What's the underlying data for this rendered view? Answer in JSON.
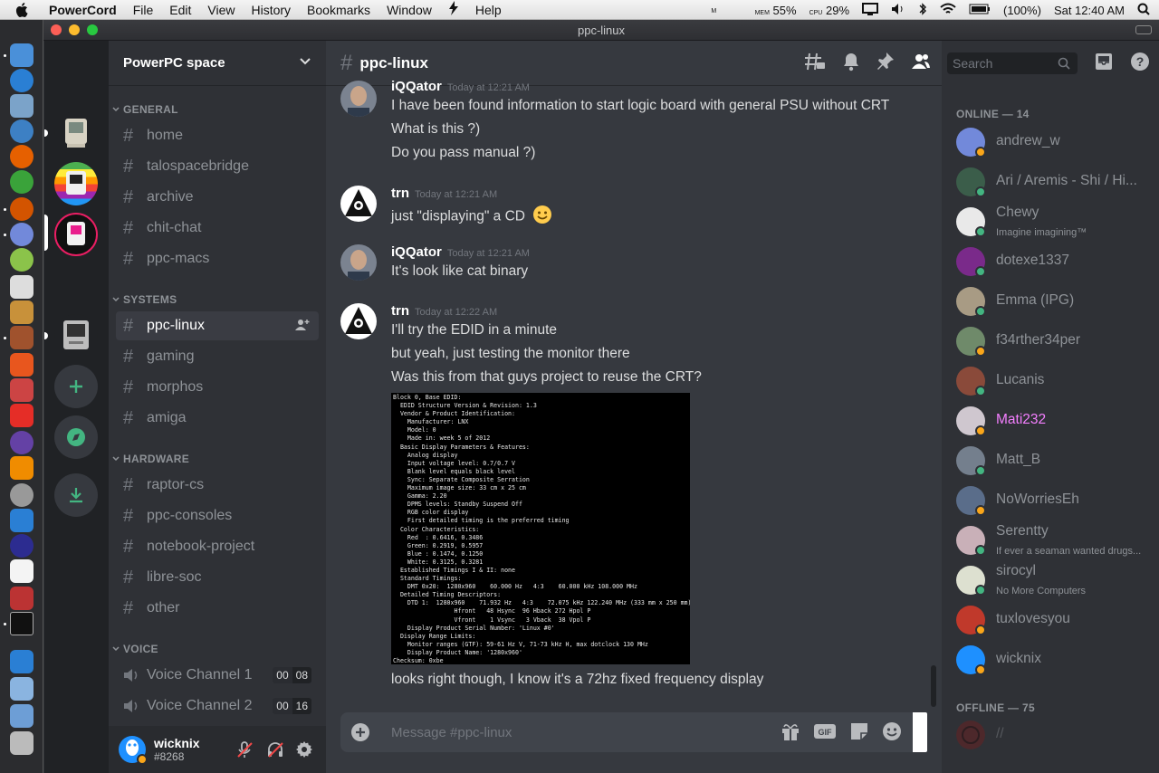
{
  "menubar": {
    "app": "PowerCord",
    "items": [
      "File",
      "Edit",
      "View",
      "History",
      "Bookmarks",
      "Window",
      "Help"
    ],
    "status": {
      "temp": "116°",
      "mem": "55%",
      "cpu": "29%",
      "battery": "(100%)",
      "clock": "Sat 12:40 AM"
    }
  },
  "window": {
    "title": "ppc-linux"
  },
  "server": {
    "name": "PowerPC space"
  },
  "categories": {
    "general": "GENERAL",
    "systems": "SYSTEMS",
    "hardware": "HARDWARE",
    "voice": "VOICE"
  },
  "channels": {
    "general": [
      "home",
      "talospacebridge",
      "archive",
      "chit-chat",
      "ppc-macs"
    ],
    "systems": [
      "ppc-linux",
      "gaming",
      "morphos",
      "amiga"
    ],
    "hardware": [
      "raptor-cs",
      "ppc-consoles",
      "notebook-project",
      "libre-soc",
      "other"
    ],
    "voice": [
      {
        "name": "Voice Channel 1",
        "a": "00",
        "b": "08"
      },
      {
        "name": "Voice Channel 2",
        "a": "00",
        "b": "16"
      }
    ]
  },
  "user": {
    "name": "wicknix",
    "discriminator": "#8268"
  },
  "chat": {
    "channel": "ppc-linux",
    "search_placeholder": "Search",
    "composer_placeholder": "Message #ppc-linux",
    "messages": [
      {
        "author": "iQQator",
        "time": "Today at 12:21 AM",
        "lines": [
          "I have been found information to start logic board with general PSU without CRT",
          "What is this ?)",
          "Do you pass manual ?)"
        ]
      },
      {
        "author": "trn",
        "time": "Today at 12:21 AM",
        "lines": [
          "just \"displaying\" a CD"
        ]
      },
      {
        "author": "iQQator",
        "time": "Today at 12:21 AM",
        "lines": [
          "It's look like cat binary"
        ]
      },
      {
        "author": "trn",
        "time": "Today at 12:22 AM",
        "lines": [
          "I'll try the EDID in a minute",
          "but yeah, just testing the monitor there",
          "Was this from that guys project to reuse the CRT?"
        ],
        "after_image": "looks right though, I know it's a 72hz fixed frequency display"
      }
    ],
    "edid_text": "Block 0, Base EDID:\n  EDID Structure Version & Revision: 1.3\n  Vendor & Product Identification:\n    Manufacturer: LNX\n    Model: 0\n    Made in: week 5 of 2012\n  Basic Display Parameters & Features:\n    Analog display\n    Input voltage level: 0.7/0.7 V\n    Blank level equals black level\n    Sync: Separate Composite Serration\n    Maximum image size: 33 cm x 25 cm\n    Gamma: 2.20\n    DPMS levels: Standby Suspend Off\n    RGB color display\n    First detailed timing is the preferred timing\n  Color Characteristics:\n    Red  : 0.6416, 0.3486\n    Green: 0.2919, 0.5957\n    Blue : 0.1474, 0.1250\n    White: 0.3125, 0.3281\n  Established Timings I & II: none\n  Standard Timings:\n    DMT 0x20:  1280x960    60.000 Hz   4:3    60.000 kHz 108.000 MHz\n  Detailed Timing Descriptors:\n    DTD 1:  1280x960    71.932 Hz   4:3    72.075 kHz 122.240 MHz (333 mm x 250 mm)\n                 Hfront   48 Hsync  96 Hback 272 Hpol P\n                 Vfront    1 Vsync   3 Vback  38 Vpol P\n    Display Product Serial Number: 'Linux #0'\n  Display Range Limits:\n    Monitor ranges (GTF): 59-61 Hz V, 71-73 kHz H, max dotclock 130 MHz\n    Display Product Name: '1280x960'\nChecksum: 0xbe"
  },
  "members": {
    "online_header": "ONLINE — 14",
    "offline_header": "OFFLINE — 75",
    "online": [
      {
        "name": "andrew_w",
        "status": "",
        "color": "#7289da",
        "st": "#faa61a",
        "highlight": false
      },
      {
        "name": "Ari / Aremis - Shi / Hi...",
        "status": "",
        "color": "#3b5d4a",
        "st": "#43b581",
        "highlight": false
      },
      {
        "name": "Chewy",
        "status": "Imagine imagining™",
        "color": "#e9e9e9",
        "st": "#43b581",
        "highlight": false
      },
      {
        "name": "dotexe1337",
        "status": "",
        "color": "#7a2a8a",
        "st": "#43b581",
        "highlight": false
      },
      {
        "name": "Emma (IPG)",
        "status": "",
        "color": "#a89b84",
        "st": "#43b581",
        "highlight": false
      },
      {
        "name": "f34rther34per",
        "status": "",
        "color": "#6f8a6a",
        "st": "#faa61a",
        "highlight": false
      },
      {
        "name": "Lucanis",
        "status": "",
        "color": "#8a4a3a",
        "st": "#43b581",
        "highlight": false
      },
      {
        "name": "Mati232",
        "status": "",
        "color": "#cfc7cf",
        "st": "#faa61a",
        "highlight": true
      },
      {
        "name": "Matt_B",
        "status": "",
        "color": "#747f8d",
        "st": "#43b581",
        "highlight": false
      },
      {
        "name": "NoWorriesEh",
        "status": "",
        "color": "#5a6d8a",
        "st": "#faa61a",
        "highlight": false
      },
      {
        "name": "Serentty",
        "status": "If ever a seaman wanted drugs...",
        "color": "#c9b0b8",
        "st": "#43b581",
        "highlight": false
      },
      {
        "name": "sirocyl",
        "status": "No More Computers",
        "color": "#dde0d0",
        "st": "#43b581",
        "highlight": false
      },
      {
        "name": "tuxlovesyou",
        "status": "",
        "color": "#c0392b",
        "st": "#faa61a",
        "highlight": false
      },
      {
        "name": "wicknix",
        "status": "",
        "color": "#1e90ff",
        "st": "#faa61a",
        "highlight": false
      }
    ],
    "offline": [
      {
        "name": "//"
      }
    ]
  },
  "colors": {
    "accent": "#7289da",
    "online": "#43b581",
    "idle": "#faa61a",
    "highlight_name": "#f47fff"
  }
}
